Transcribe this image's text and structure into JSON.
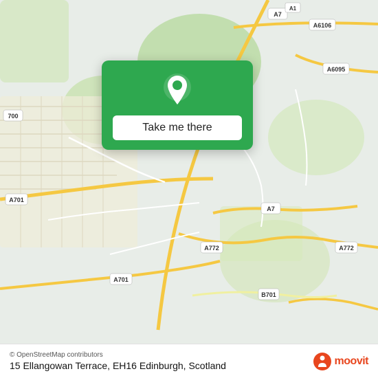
{
  "map": {
    "background_color": "#e8ede8",
    "accent_green": "#2ea84f"
  },
  "card": {
    "button_label": "Take me there",
    "pin_icon": "location-pin"
  },
  "bottom_bar": {
    "osm_credit": "© OpenStreetMap contributors",
    "address": "15 Ellangowan Terrace, EH16 Edinburgh, Scotland",
    "moovit_label": "moovit"
  },
  "road_labels": [
    {
      "id": "a7_top",
      "text": "A7"
    },
    {
      "id": "a6106",
      "text": "A6106"
    },
    {
      "id": "a6095",
      "text": "A6095"
    },
    {
      "id": "a701_left",
      "text": "A701"
    },
    {
      "id": "a701_bottom",
      "text": "A701"
    },
    {
      "id": "a772_mid",
      "text": "A772"
    },
    {
      "id": "a772_right",
      "text": "A772"
    },
    {
      "id": "b701",
      "text": "B701"
    },
    {
      "id": "a7_mid",
      "text": "A7"
    },
    {
      "id": "a7_label2",
      "text": "A7"
    },
    {
      "id": "a700",
      "text": "700"
    }
  ]
}
